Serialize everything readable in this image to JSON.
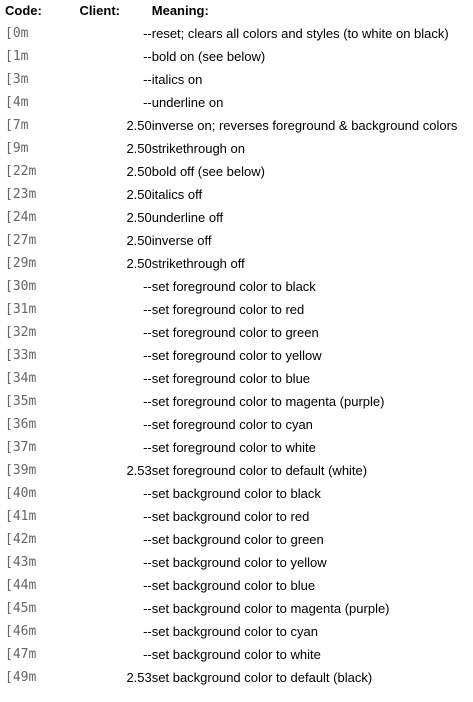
{
  "headers": {
    "code": "Code:",
    "client": "Client:",
    "meaning": "Meaning:"
  },
  "rows": [
    {
      "code": "[0m",
      "client": "--",
      "meaning": "reset; clears all colors and styles (to white on black)"
    },
    {
      "code": "[1m",
      "client": "--",
      "meaning": "bold on (see below)"
    },
    {
      "code": "[3m",
      "client": "--",
      "meaning": "italics on"
    },
    {
      "code": "[4m",
      "client": "--",
      "meaning": "underline on"
    },
    {
      "code": "[7m",
      "client": "2.50",
      "meaning": "inverse on; reverses foreground & background colors"
    },
    {
      "code": "[9m",
      "client": "2.50",
      "meaning": "strikethrough on"
    },
    {
      "code": "[22m",
      "client": "2.50",
      "meaning": "bold off (see below)"
    },
    {
      "code": "[23m",
      "client": "2.50",
      "meaning": "italics off"
    },
    {
      "code": "[24m",
      "client": "2.50",
      "meaning": "underline off"
    },
    {
      "code": "[27m",
      "client": "2.50",
      "meaning": "inverse off"
    },
    {
      "code": "[29m",
      "client": "2.50",
      "meaning": "strikethrough off"
    },
    {
      "code": "[30m",
      "client": "--",
      "meaning": "set foreground color to black"
    },
    {
      "code": "[31m",
      "client": "--",
      "meaning": "set foreground color to red"
    },
    {
      "code": "[32m",
      "client": "--",
      "meaning": "set foreground color to green"
    },
    {
      "code": "[33m",
      "client": "--",
      "meaning": "set foreground color to yellow"
    },
    {
      "code": "[34m",
      "client": "--",
      "meaning": "set foreground color to blue"
    },
    {
      "code": "[35m",
      "client": "--",
      "meaning": "set foreground color to magenta (purple)"
    },
    {
      "code": "[36m",
      "client": "--",
      "meaning": "set foreground color to cyan"
    },
    {
      "code": "[37m",
      "client": "--",
      "meaning": "set foreground color to white"
    },
    {
      "code": "[39m",
      "client": "2.53",
      "meaning": "set foreground color to default (white)"
    },
    {
      "code": "[40m",
      "client": "--",
      "meaning": "set background color to black"
    },
    {
      "code": "[41m",
      "client": "--",
      "meaning": "set background color to red"
    },
    {
      "code": "[42m",
      "client": "--",
      "meaning": "set background color to green"
    },
    {
      "code": "[43m",
      "client": "--",
      "meaning": "set background color to yellow"
    },
    {
      "code": "[44m",
      "client": "--",
      "meaning": "set background color to blue"
    },
    {
      "code": "[45m",
      "client": "--",
      "meaning": "set background color to magenta (purple)"
    },
    {
      "code": "[46m",
      "client": "--",
      "meaning": "set background color to cyan"
    },
    {
      "code": "[47m",
      "client": "--",
      "meaning": "set background color to white"
    },
    {
      "code": "[49m",
      "client": "2.53",
      "meaning": "set background color to default (black)"
    }
  ]
}
